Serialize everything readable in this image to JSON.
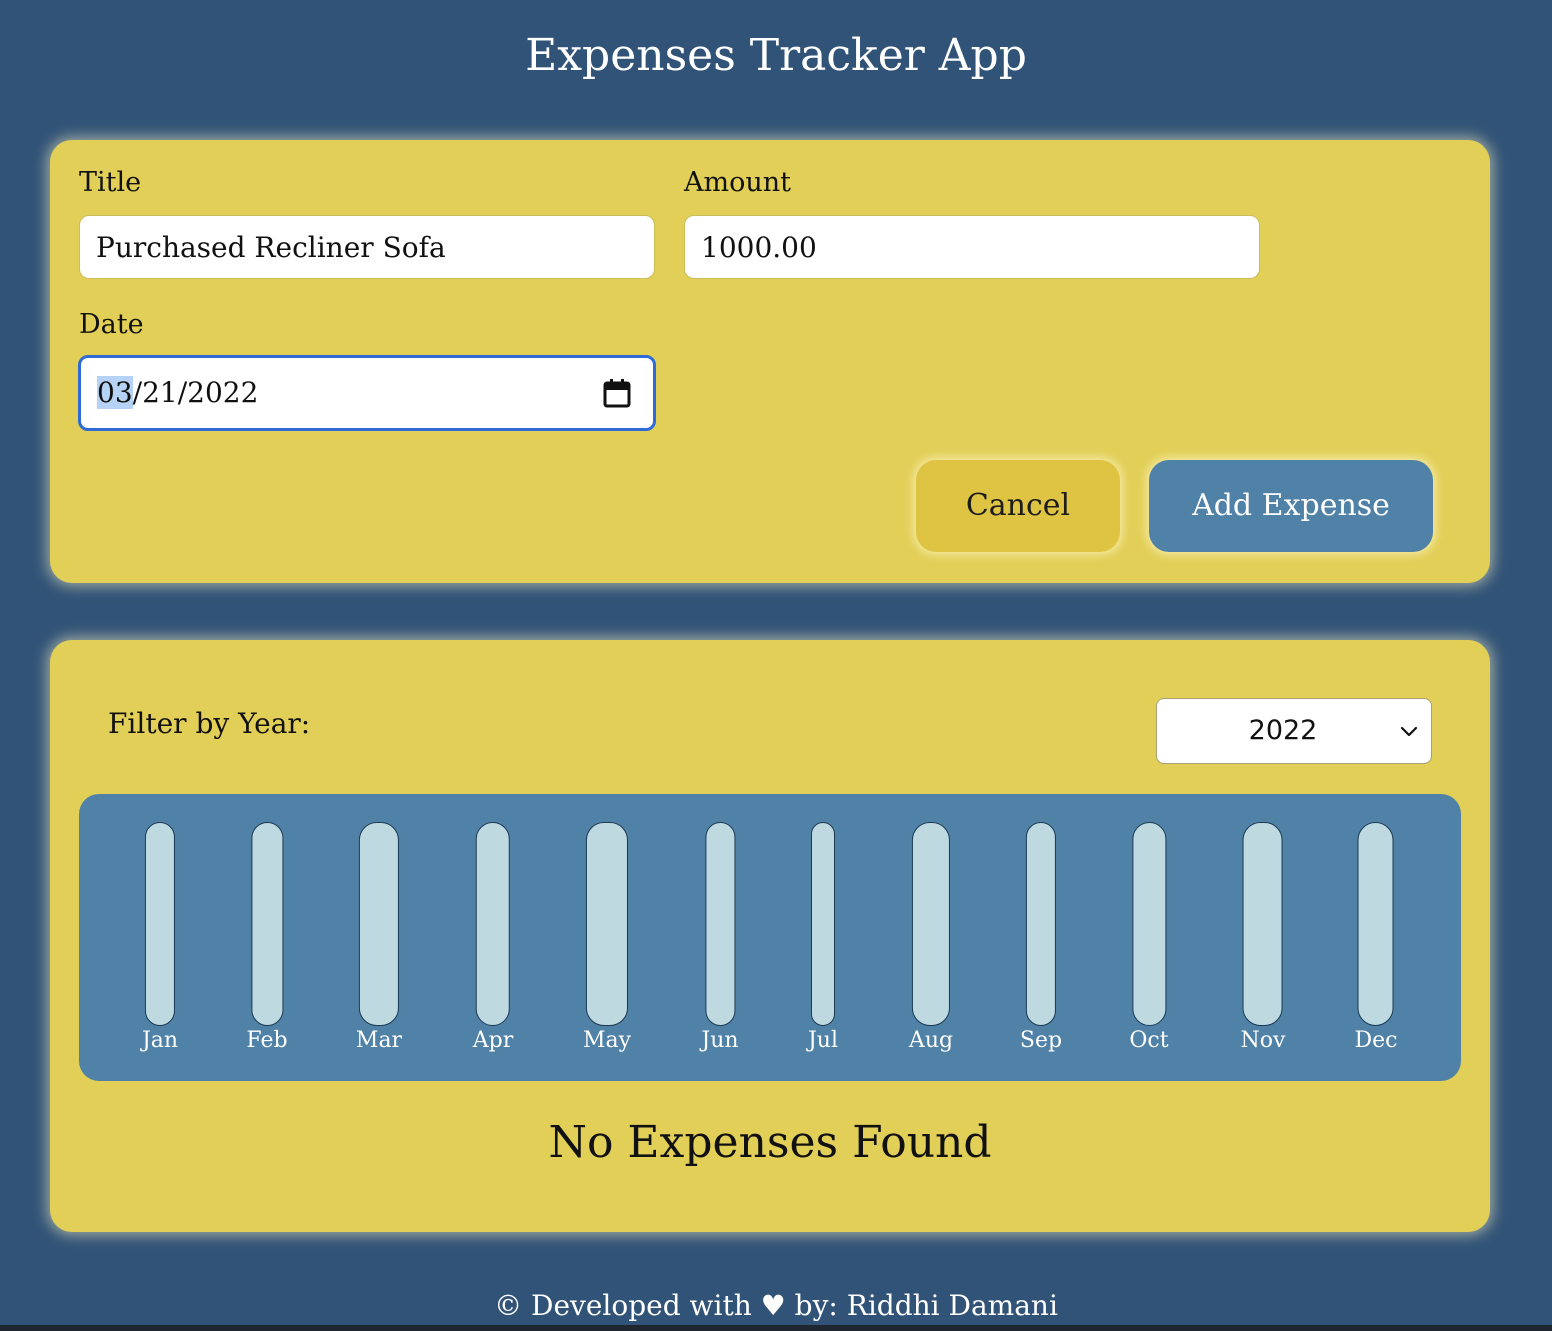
{
  "header": {
    "title": "Expenses Tracker App"
  },
  "form": {
    "title_label": "Title",
    "title_value": "Purchased Recliner Sofa",
    "amount_label": "Amount",
    "amount_value": "1000.00",
    "date_label": "Date",
    "date_month": "03",
    "date_rest": "/21/2022",
    "cancel_label": "Cancel",
    "add_label": "Add Expense"
  },
  "filter": {
    "label": "Filter by Year:",
    "selected_year": "2022"
  },
  "chart_data": {
    "type": "bar",
    "categories": [
      "Jan",
      "Feb",
      "Mar",
      "Apr",
      "May",
      "Jun",
      "Jul",
      "Aug",
      "Sep",
      "Oct",
      "Nov",
      "Dec"
    ],
    "values": [
      0,
      0,
      0,
      0,
      0,
      0,
      0,
      0,
      0,
      0,
      0,
      0
    ],
    "title": "",
    "xlabel": "",
    "ylabel": ""
  },
  "empty_message": "No Expenses Found",
  "footer": {
    "prefix": "© Developed with",
    "heart": "♥",
    "suffix": "by: Riddhi Damani"
  },
  "colors": {
    "background": "#315377",
    "card": "#e2cf58",
    "primary_button": "#5081a7",
    "cancel_button": "#dfc444",
    "chart_background": "#5081a7",
    "bar_track": "#bedae0",
    "date_focus": "#2f6bd6"
  }
}
